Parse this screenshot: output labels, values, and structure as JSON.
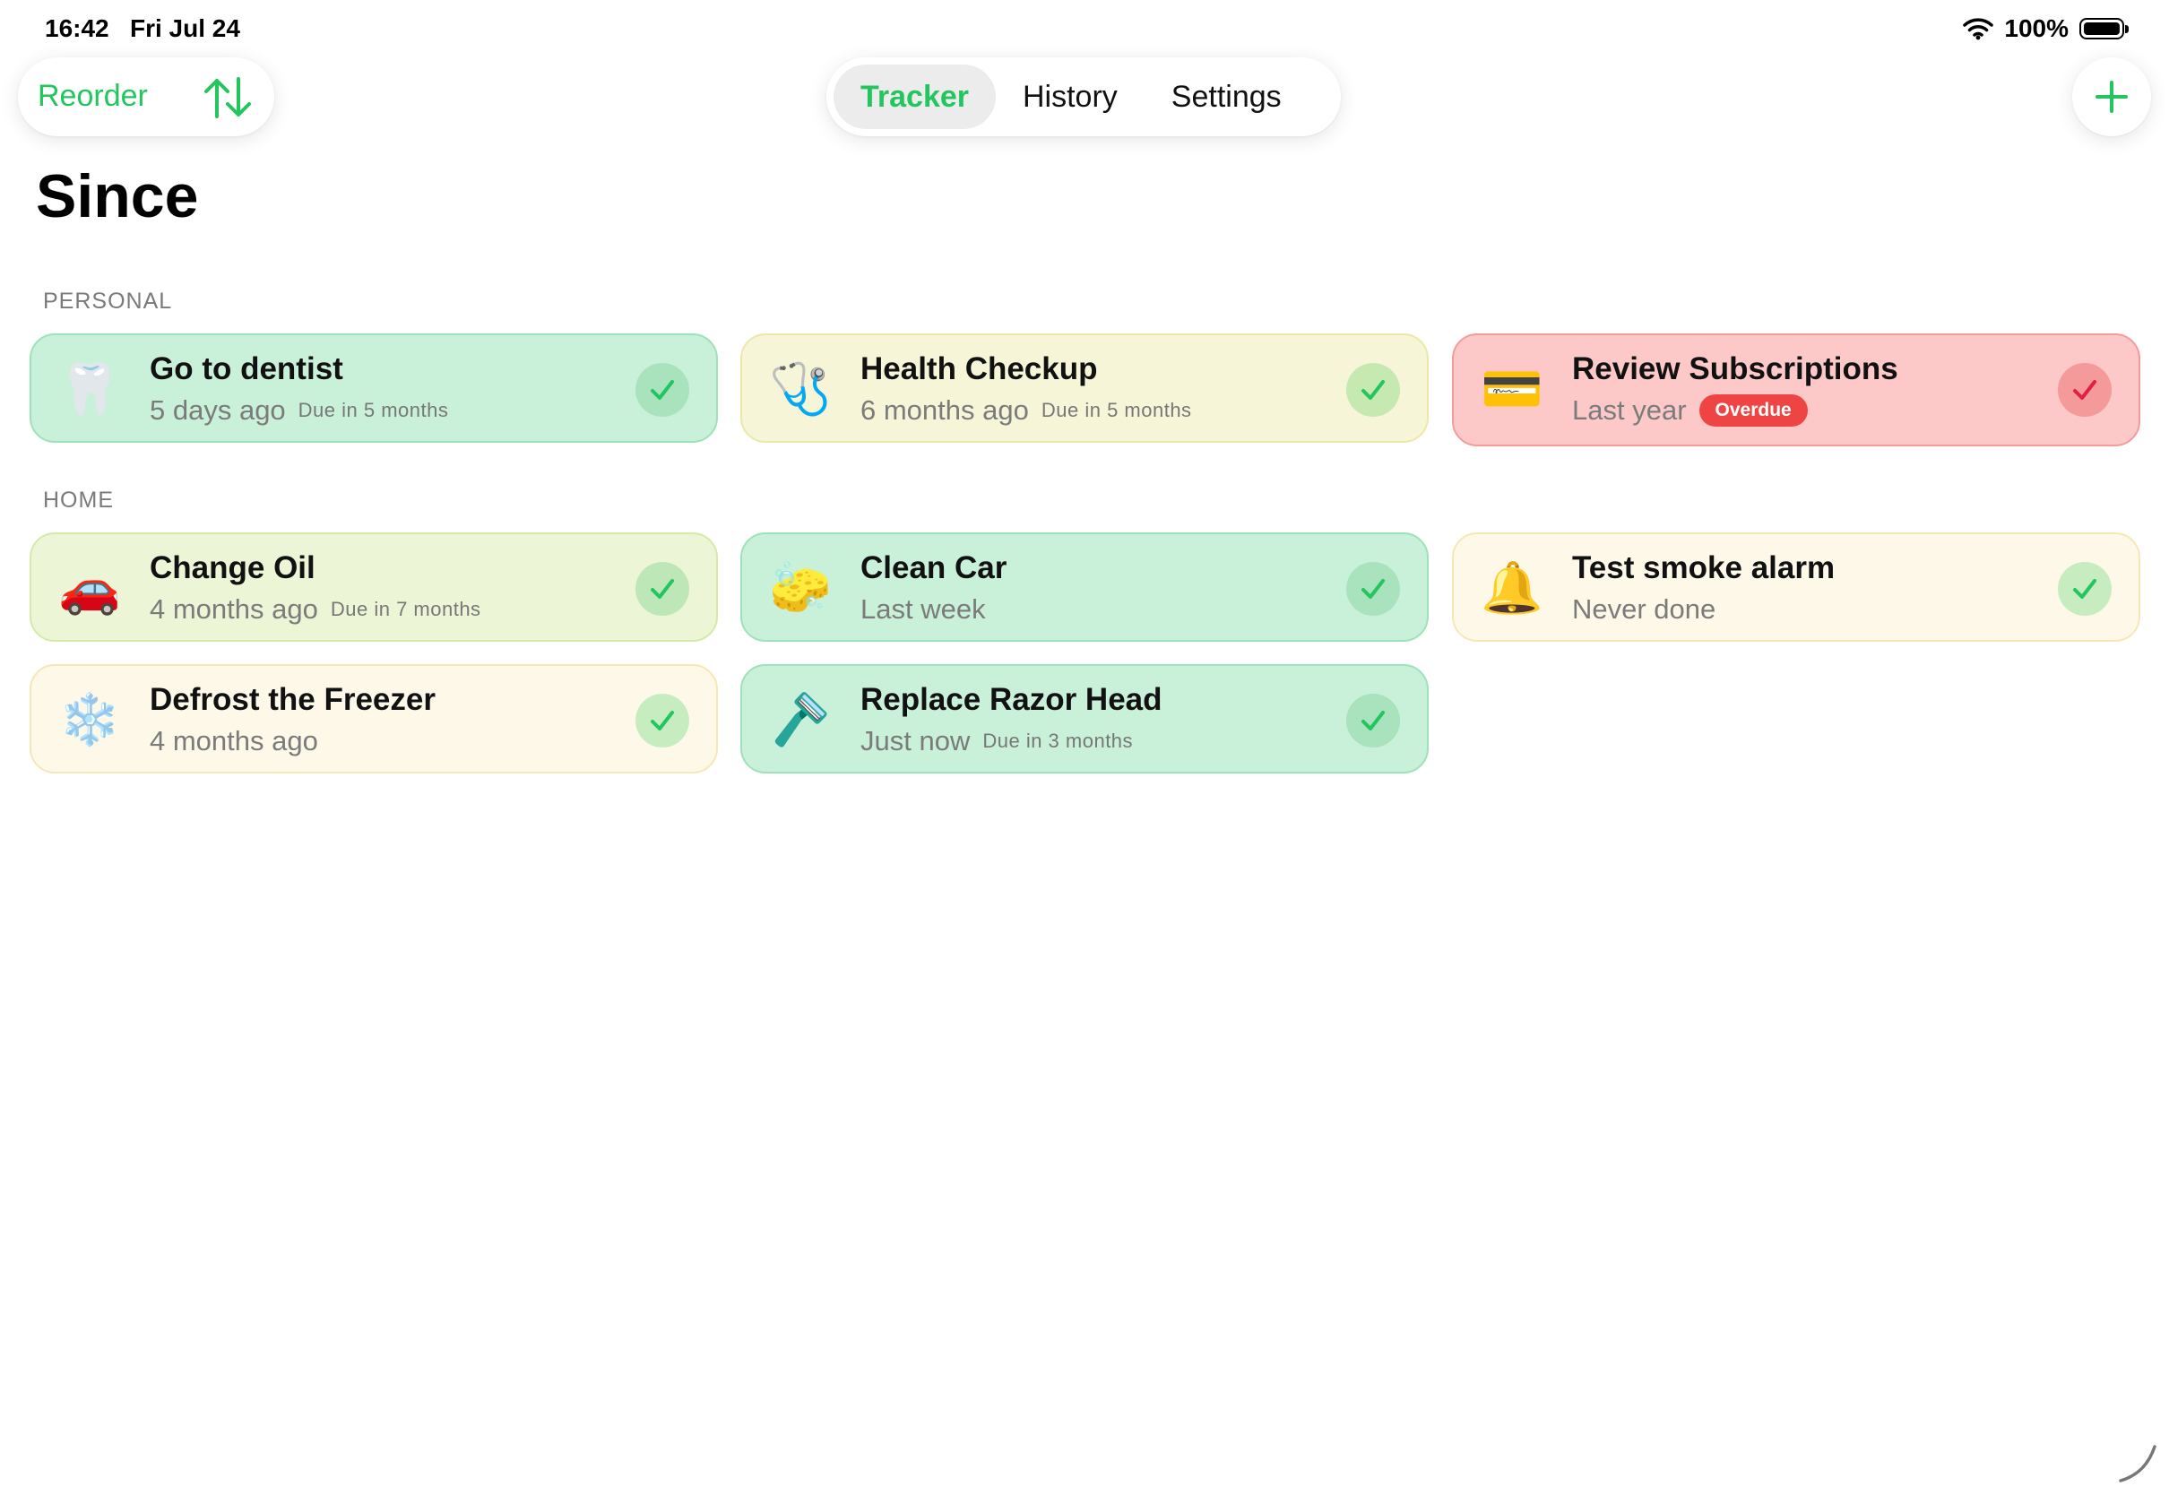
{
  "status_bar": {
    "time": "16:42",
    "date": "Fri Jul 24",
    "battery": "100%"
  },
  "toolbar": {
    "reorder_label": "Reorder"
  },
  "tabs": [
    {
      "label": "Tracker",
      "active": true
    },
    {
      "label": "History",
      "active": false
    },
    {
      "label": "Settings",
      "active": false
    }
  ],
  "page_title": "Since",
  "sections": [
    {
      "label": "PERSONAL",
      "items": [
        {
          "emoji": "🦷",
          "title": "Go to dentist",
          "since": "5 days ago",
          "due": "Due in 5 months",
          "status": "ok",
          "color": "green"
        },
        {
          "emoji": "🩺",
          "title": "Health Checkup",
          "since": "6 months ago",
          "due": "Due in 5 months",
          "status": "ok",
          "color": "yellow"
        },
        {
          "emoji": "💳",
          "title": "Review Subscriptions",
          "since": "Last year",
          "badge": "Overdue",
          "status": "overdue",
          "color": "red"
        }
      ]
    },
    {
      "label": "HOME",
      "items": [
        {
          "emoji": "🚗",
          "title": "Change Oil",
          "since": "4 months ago",
          "due": "Due in 7 months",
          "status": "ok",
          "color": "lime"
        },
        {
          "emoji": "🧽",
          "title": "Clean Car",
          "since": "Last week",
          "status": "ok",
          "color": "green"
        },
        {
          "emoji": "🔔",
          "title": "Test smoke alarm",
          "since": "Never done",
          "status": "ok",
          "color": "cream"
        },
        {
          "emoji": "❄️",
          "title": "Defrost the Freezer",
          "since": "4 months ago",
          "status": "ok",
          "color": "cream"
        },
        {
          "emoji": "🪒",
          "title": "Replace Razor Head",
          "since": "Just now",
          "due": "Due in 3 months",
          "status": "ok",
          "color": "green"
        }
      ]
    }
  ],
  "colors": {
    "accent": "#22c55e",
    "overdue": "#ef4444",
    "check_ok": "#22c55e",
    "check_overdue": "#e11d48"
  },
  "icons": {
    "reorder": "arrow-up-down-icon",
    "add": "plus-icon",
    "check": "checkmark-icon",
    "wifi": "wifi-icon",
    "battery": "battery-icon"
  }
}
